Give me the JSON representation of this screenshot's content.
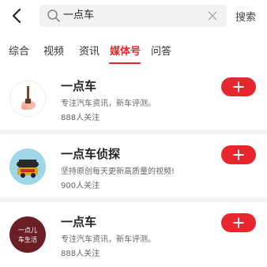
{
  "search": {
    "value": "一点车",
    "button_label": "搜索"
  },
  "tabs": [
    {
      "label": "综合"
    },
    {
      "label": "视频"
    },
    {
      "label": "资讯"
    },
    {
      "label": "媒体号"
    },
    {
      "label": "问答"
    }
  ],
  "active_tab": "媒体号",
  "results": [
    {
      "title": "一点车",
      "desc": "专注汽车资讯，新车评测。",
      "followers": "888人关注",
      "avatar_icon": "car-key-avatar-icon"
    },
    {
      "title": "一点车侦探",
      "desc": "坚持原创每天更新高质量的视频!",
      "followers": "900人关注",
      "avatar_icon": "car-detective-avatar-icon"
    },
    {
      "title": "一点车",
      "desc": "专注汽车资讯，新车评测。",
      "followers": "888人关注",
      "avatar_icon": "yidian-car-life-avatar-icon",
      "avatar_text_1": "一点儿",
      "avatar_text_2": "车生活"
    }
  ],
  "colors": {
    "accent": "#e8262d",
    "avatar_brown": "#6b1f25"
  }
}
